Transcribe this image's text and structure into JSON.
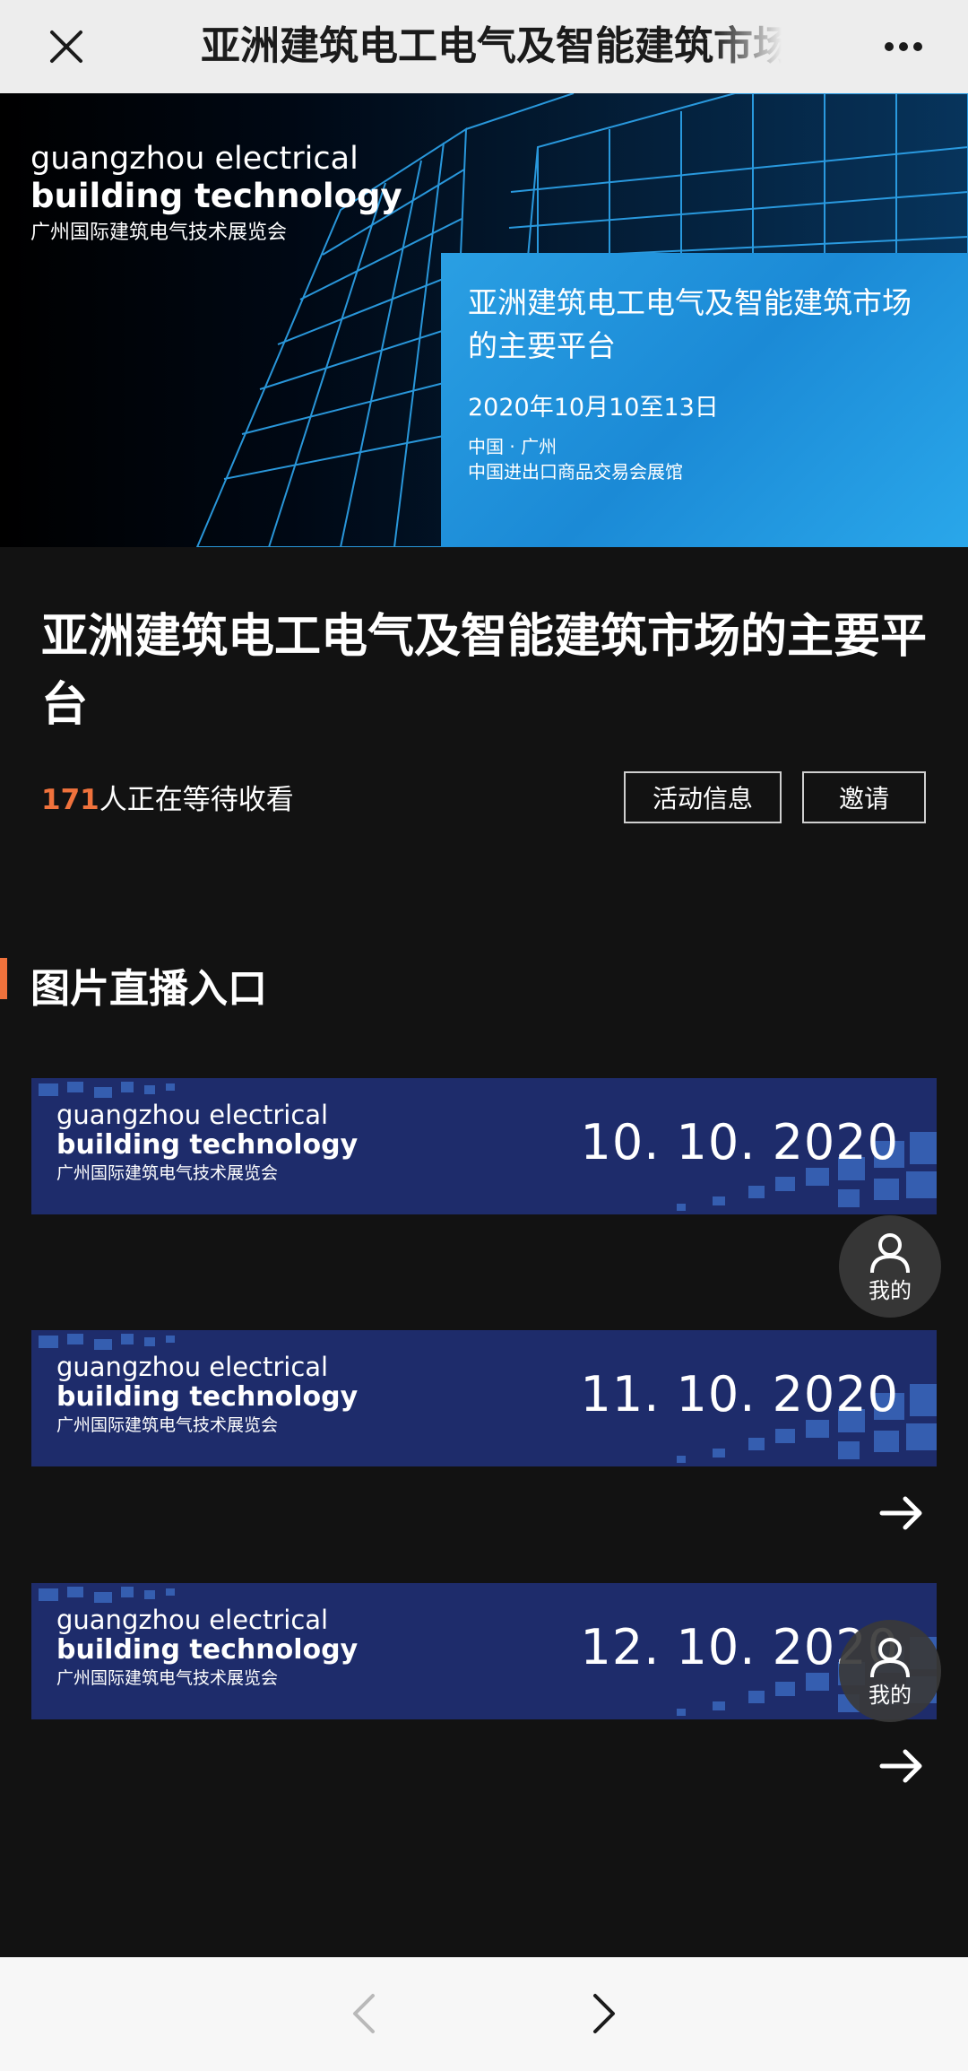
{
  "topbar": {
    "title": "亚洲建筑电工电气及智能建筑市场的主要平台"
  },
  "banner": {
    "brand_line1": "guangzhou electrical",
    "brand_line2": "building technology",
    "brand_cn": "广州国际建筑电气技术展览会",
    "panel_title": "亚洲建筑电工电气及智能建筑市场的主要平台",
    "panel_date": "2020年10月10至13日",
    "panel_city": "中国 · 广州",
    "panel_venue": "中国进出口商品交易会展馆"
  },
  "headline": "亚洲建筑电工电气及智能建筑市场的主要平台",
  "waiting": {
    "count": "171",
    "text": "人正在等待收看"
  },
  "buttons": {
    "info": "活动信息",
    "invite": "邀请"
  },
  "section": {
    "title": "图片直播入口"
  },
  "cards": [
    {
      "brand_line1": "guangzhou electrical",
      "brand_line2": "building technology",
      "brand_cn": "广州国际建筑电气技术展览会",
      "date": "10. 10. 2020"
    },
    {
      "brand_line1": "guangzhou electrical",
      "brand_line2": "building technology",
      "brand_cn": "广州国际建筑电气技术展览会",
      "date": "11. 10. 2020"
    },
    {
      "brand_line1": "guangzhou electrical",
      "brand_line2": "building technology",
      "brand_cn": "广州国际建筑电气技术展览会",
      "date": "12. 10. 2020"
    }
  ],
  "fab": {
    "label": "我的"
  },
  "colors": {
    "accent": "#f0723c",
    "card_bg": "#1e2c6b",
    "banner_blue": "#1b8ad6",
    "page_bg": "#121212"
  },
  "icons": {
    "close": "close-icon",
    "more": "more-dots-icon",
    "arrow": "arrow-right-icon",
    "user": "user-icon",
    "back": "chevron-left-icon",
    "forward": "chevron-right-icon"
  }
}
